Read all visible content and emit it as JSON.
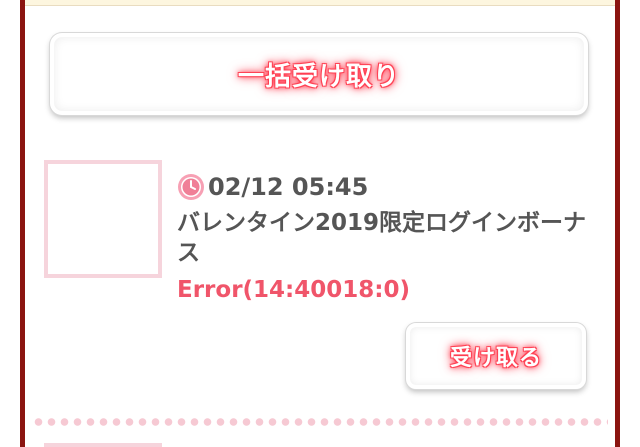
{
  "bulk_receive": {
    "label": "一括受け取り"
  },
  "items": [
    {
      "timestamp": "02/12 05:45",
      "title": "バレンタイン2019限定ログインボーナス",
      "error": "Error(14:40018:0)",
      "receive_label": "受け取る",
      "icon": "clock-icon"
    }
  ],
  "colors": {
    "frame_border": "#8b1410",
    "accent_pink": "#f0556a",
    "glow_red": "#ff3b4f",
    "thumb_border": "#f6d4dc",
    "divider_dots": "#f6c9d3",
    "text_gray": "#555555",
    "top_strip": "#fdf6df"
  }
}
